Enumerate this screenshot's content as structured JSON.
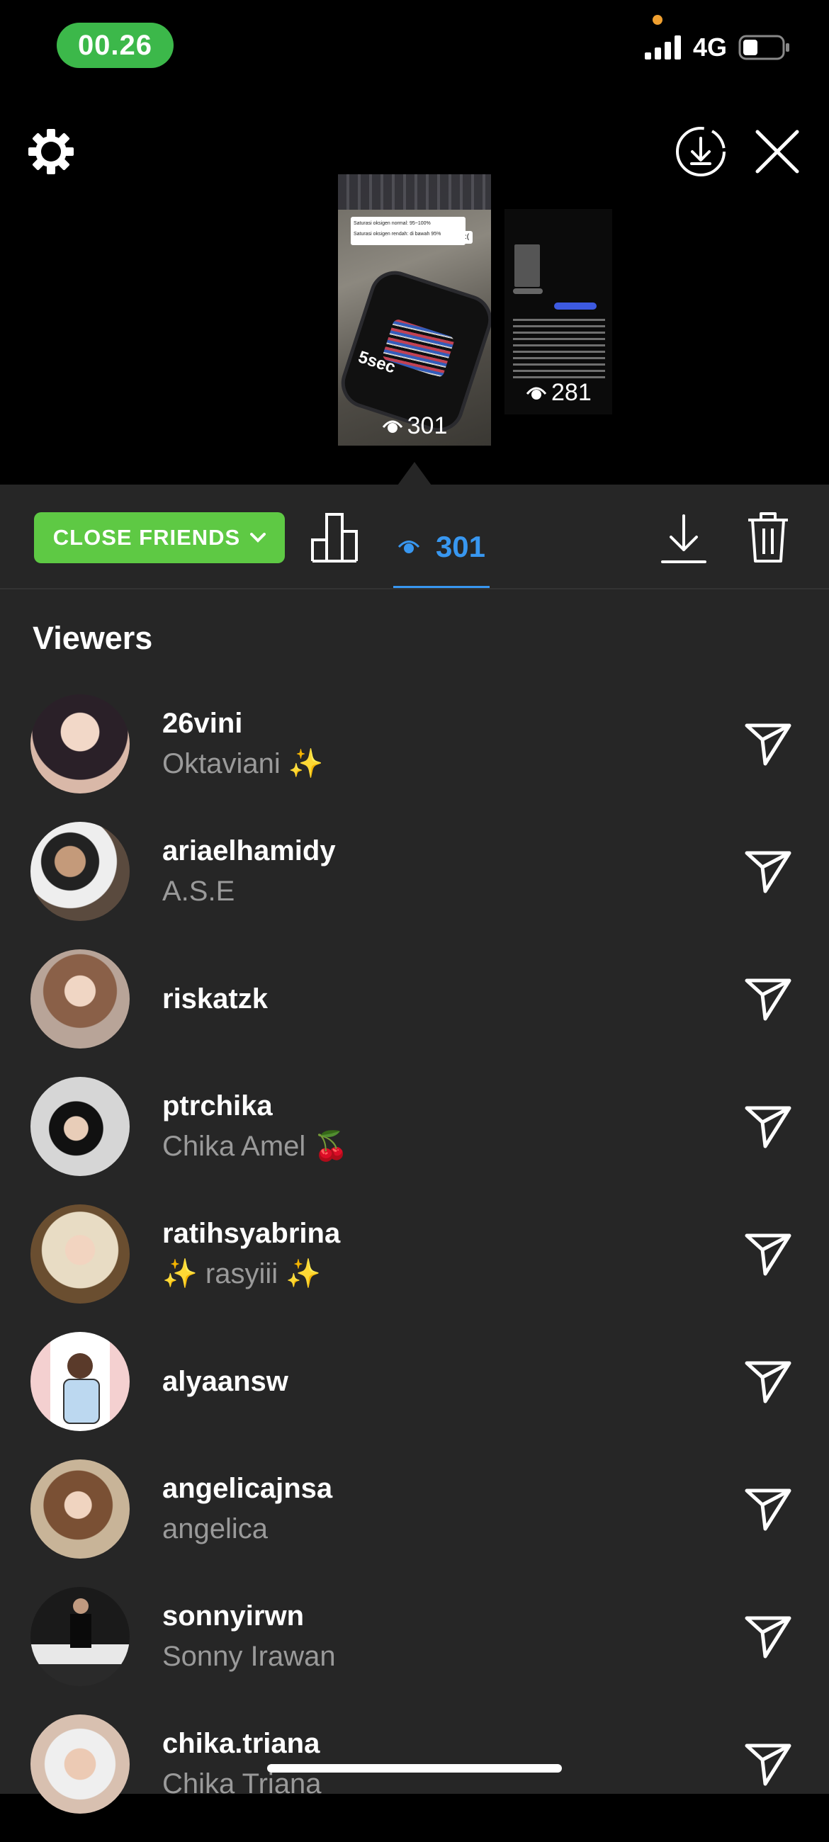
{
  "status": {
    "time": "00.26",
    "network": "4G"
  },
  "thumbnails": [
    {
      "views": "301",
      "overlay_text": "5sec",
      "caption_lines": [
        "Saturasi oksigen normal: 95~100%",
        "Saturasi oksigen rendah: di bawah 95%"
      ]
    },
    {
      "views": "281"
    }
  ],
  "toolbar": {
    "audience_label": "CLOSE FRIENDS",
    "view_count": "301"
  },
  "section_title": "Viewers",
  "viewers": [
    {
      "username": "26vini",
      "full_name": "Oktaviani ✨",
      "avatar_color": "#d9b8a8"
    },
    {
      "username": "ariaelhamidy",
      "full_name": "A.S.E",
      "avatar_color": "#7a6a5a"
    },
    {
      "username": "riskatzk",
      "full_name": "",
      "avatar_color": "#b59a88"
    },
    {
      "username": "ptrchika",
      "full_name": "Chika Amel 🍒",
      "avatar_color": "#c8c8c8"
    },
    {
      "username": "ratihsyabrina",
      "full_name": "✨ rasyiii ✨",
      "avatar_color": "#e8dcc8"
    },
    {
      "username": "alyaansw",
      "full_name": "",
      "avatar_color": "#f4d4d4"
    },
    {
      "username": "angelicajnsa",
      "full_name": "angelica",
      "avatar_color": "#a08060"
    },
    {
      "username": "sonnyirwn",
      "full_name": "Sonny Irawan",
      "avatar_color": "#3a3a3a"
    },
    {
      "username": "chika.triana",
      "full_name": "Chika Triana",
      "avatar_color": "#d8c0b0"
    }
  ],
  "colors": {
    "accent": "#3897f0",
    "close_friends_green": "#5ec944",
    "time_pill_green": "#3cb84a",
    "sheet_bg": "#262626"
  }
}
